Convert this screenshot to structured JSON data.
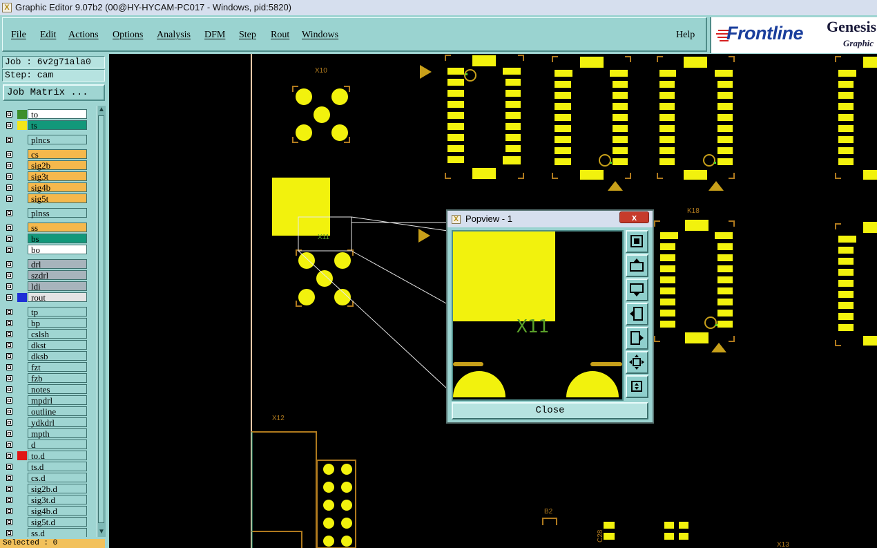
{
  "window": {
    "title": "Graphic Editor 9.07b2 (00@HY-HYCAM-PC017 - Windows, pid:5820)"
  },
  "menu": {
    "items": [
      "File",
      "Edit",
      "Actions",
      "Options",
      "Analysis",
      "DFM",
      "Step",
      "Rout",
      "Windows"
    ],
    "help": "Help"
  },
  "logo": {
    "brand": "Frontline",
    "product": "Genesis",
    "subtitle": "Graphic"
  },
  "job": {
    "job_label": "Job : 6v2g71ala0",
    "step_label": "Step: cam",
    "matrix_button": "Job Matrix ..."
  },
  "layers": [
    {
      "name": "to",
      "color": "#ffffff",
      "swatch": "#3d8f2c"
    },
    {
      "name": "ts",
      "color": "#12987a",
      "swatch": "#f2e61a"
    },
    {
      "name": "plncs",
      "color": "#9fd5d2",
      "swatch": ""
    },
    {
      "name": "cs",
      "color": "#f5b84c",
      "swatch": ""
    },
    {
      "name": "sig2b",
      "color": "#f5b84c",
      "swatch": ""
    },
    {
      "name": "sig3t",
      "color": "#f5b84c",
      "swatch": ""
    },
    {
      "name": "sig4b",
      "color": "#f5b84c",
      "swatch": ""
    },
    {
      "name": "sig5t",
      "color": "#f5b84c",
      "swatch": ""
    },
    {
      "name": "plnss",
      "color": "#9fd5d2",
      "swatch": ""
    },
    {
      "name": "ss",
      "color": "#f5b84c",
      "swatch": ""
    },
    {
      "name": "bs",
      "color": "#12987a",
      "swatch": ""
    },
    {
      "name": "bo",
      "color": "#ffffff",
      "swatch": ""
    },
    {
      "name": "drl",
      "color": "#a7b4bc",
      "swatch": ""
    },
    {
      "name": "szdrl",
      "color": "#a7b4bc",
      "swatch": ""
    },
    {
      "name": "ldi",
      "color": "#a7b4bc",
      "swatch": ""
    },
    {
      "name": "rout",
      "color": "#e4e4e4",
      "swatch": "#1f2fd6"
    },
    {
      "name": "tp",
      "color": "#9fd5d2",
      "swatch": ""
    },
    {
      "name": "bp",
      "color": "#9fd5d2",
      "swatch": ""
    },
    {
      "name": "cslsh",
      "color": "#9fd5d2",
      "swatch": ""
    },
    {
      "name": "dkst",
      "color": "#9fd5d2",
      "swatch": ""
    },
    {
      "name": "dksb",
      "color": "#9fd5d2",
      "swatch": ""
    },
    {
      "name": "fzt",
      "color": "#9fd5d2",
      "swatch": ""
    },
    {
      "name": "fzb",
      "color": "#9fd5d2",
      "swatch": ""
    },
    {
      "name": "notes",
      "color": "#9fd5d2",
      "swatch": ""
    },
    {
      "name": "mpdrl",
      "color": "#9fd5d2",
      "swatch": ""
    },
    {
      "name": "outline",
      "color": "#9fd5d2",
      "swatch": ""
    },
    {
      "name": "ydkdrl",
      "color": "#9fd5d2",
      "swatch": ""
    },
    {
      "name": "mpth",
      "color": "#9fd5d2",
      "swatch": ""
    },
    {
      "name": "d",
      "color": "#9fd5d2",
      "swatch": ""
    },
    {
      "name": "to.d",
      "color": "#9fd5d2",
      "swatch": "#e01515"
    },
    {
      "name": "ts.d",
      "color": "#9fd5d2",
      "swatch": ""
    },
    {
      "name": "cs.d",
      "color": "#9fd5d2",
      "swatch": ""
    },
    {
      "name": "sig2b.d",
      "color": "#9fd5d2",
      "swatch": ""
    },
    {
      "name": "sig3t.d",
      "color": "#9fd5d2",
      "swatch": ""
    },
    {
      "name": "sig4b.d",
      "color": "#9fd5d2",
      "swatch": ""
    },
    {
      "name": "sig5t.d",
      "color": "#9fd5d2",
      "swatch": ""
    },
    {
      "name": "ss.d",
      "color": "#9fd5d2",
      "swatch": ""
    }
  ],
  "status": {
    "selected": "Selected : 0"
  },
  "canvas": {
    "labels": [
      "X10",
      "X11",
      "X12",
      "K18",
      "B2",
      "C28",
      "X13"
    ]
  },
  "popview": {
    "title": "Popview - 1",
    "close_x": "x",
    "close_label": "Close",
    "label": "X11",
    "tools": [
      "zoom-in-icon",
      "pan-up-icon",
      "pan-down-icon",
      "pan-left-icon",
      "pan-right-icon",
      "zoom-fit-icon",
      "zoom-out-icon"
    ]
  }
}
